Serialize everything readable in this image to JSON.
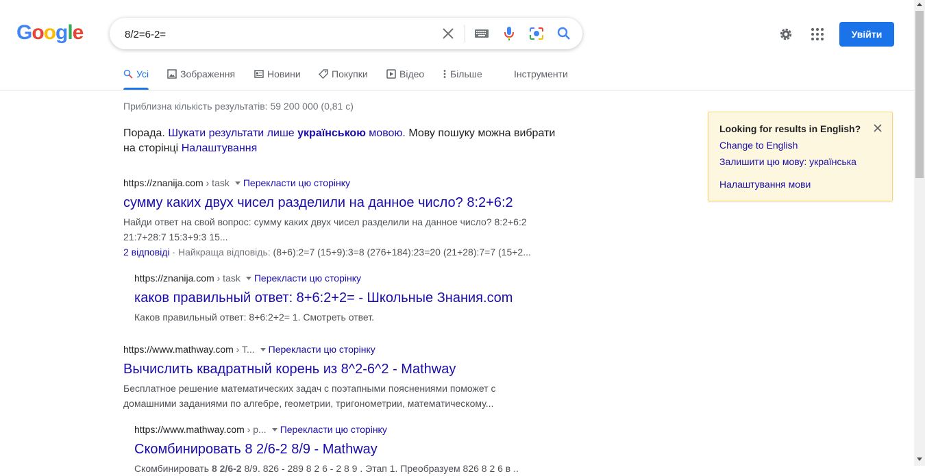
{
  "header": {
    "logo_letters": [
      "G",
      "o",
      "o",
      "g",
      "l",
      "e"
    ],
    "query": "8/2=6-2=",
    "signin_label": "Увійти",
    "icons": [
      "clear-icon",
      "keyboard-icon",
      "mic-icon",
      "lens-icon",
      "search-icon",
      "gear-icon",
      "apps-icon"
    ],
    "accent_color": "#1a73e8"
  },
  "tabs": [
    {
      "label": "Усі",
      "icon": "search-icon",
      "active": true
    },
    {
      "label": "Зображення",
      "icon": "image-icon"
    },
    {
      "label": "Новини",
      "icon": "news-icon"
    },
    {
      "label": "Покупки",
      "icon": "tag-icon"
    },
    {
      "label": "Відео",
      "icon": "play-icon"
    },
    {
      "label": "Більше",
      "icon": "more-icon"
    },
    {
      "label": "Інструменти"
    }
  ],
  "stats": "Приблизна кількість результатів: 59 200 000 (0,81 c)",
  "tip": {
    "prefix": "Порада. ",
    "link1_a": "Шукати результати лише ",
    "link1_b": "українською",
    "link1_c": " мовою",
    "middle": ". Мову пошуку можна вибрати на сторінці ",
    "link2": "Налаштування"
  },
  "results": [
    {
      "site": "https://znanija.com",
      "path": " › task",
      "translate": "Перекласти цю сторінку",
      "title": "сумму каких двух чисел разделили на данное число? 8:2+6:2",
      "snippet": "Найди ответ на свой вопрос: сумму каких двух чисел разделили на данное число? 8:2+6:2 21:7+28:7 15:3+9:3 15...",
      "answers": "2 відповіді",
      "best_label": " · Найкраща відповідь: ",
      "best_text": "(8+6):2=7 (15+9):3=8 (276+184):23=20 (21+28):7=7 (15+2..."
    },
    {
      "site": "https://znanija.com",
      "path": " › task",
      "translate": "Перекласти цю сторінку",
      "title": "каков правильный ответ: 8+6:2+2= - Школьные Знания.com",
      "snippet": "Каков правильный ответ: 8+6:2+2= 1. Смотреть ответ."
    },
    {
      "site": "https://www.mathway.com",
      "path": " › T...",
      "translate": "Перекласти цю сторінку",
      "title": "Вычислить квадратный корень из 8^2-6^2 - Mathway",
      "snippet": "Бесплатное решение математических задач с поэтапными пояснениями поможет с домашними заданиями по алгебре, геометрии, тригонометрии, математическому..."
    },
    {
      "site": "https://www.mathway.com",
      "path": " › p...",
      "translate": "Перекласти цю сторінку",
      "title": "Скомбинировать 8 2/6-2 8/9 - Mathway",
      "snippet_a": "Скомбинировать ",
      "snippet_b": "8 2/6-2",
      "snippet_c": " 8/9. 826 - 289 8 2 6 - 2 8 9 . Этап 1. Преобразуем 826 8 2 6 в ..."
    }
  ],
  "lang_panel": {
    "title": "Looking for results in English?",
    "change": "Change to English",
    "keep": "Залишити цю мову: українська",
    "settings": "Налаштування мови"
  }
}
